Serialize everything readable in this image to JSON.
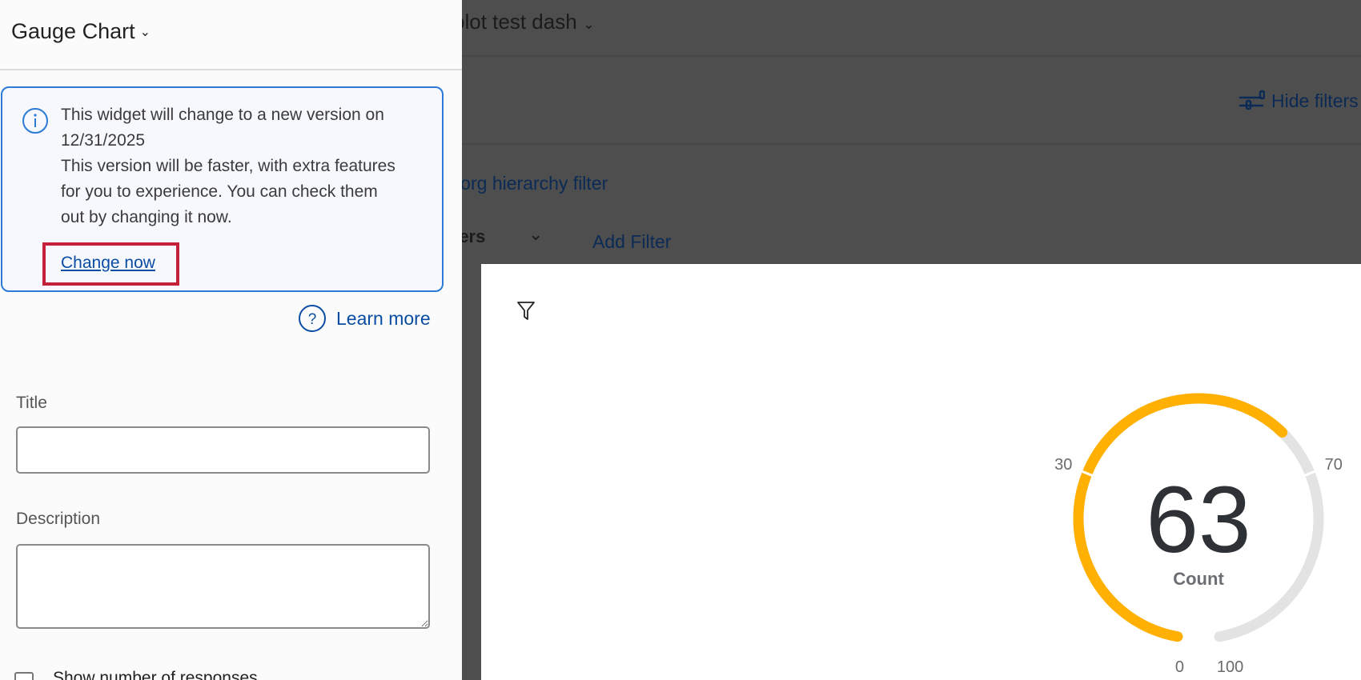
{
  "sidebar": {
    "widget_type": "Gauge Chart",
    "notice": {
      "lines": [
        "This widget will change to a new version on",
        "12/31/2025",
        "This version will be faster, with extra features",
        "for you to experience. You can check them",
        "out by changing it now."
      ],
      "action": "Change now"
    },
    "learn_more": "Learn more",
    "title_label": "Title",
    "title_value": "",
    "description_label": "Description",
    "description_value": "",
    "show_responses_label": "Show number of responses"
  },
  "background": {
    "dashboard_name": "plot test dash",
    "hide_filters": "Hide filters",
    "org_filter": "n org hierarchy filter",
    "filters_label": "ters",
    "add_filter": "Add Filter"
  },
  "colors": {
    "accent": "#0a4da2",
    "gauge_fill": "#ffb000",
    "gauge_track": "#e3e3e3",
    "highlight": "#c5203a"
  },
  "chart_data": {
    "type": "gauge",
    "value": 63,
    "value_label": "63",
    "metric_label": "Count",
    "min": 0,
    "max": 100,
    "thresholds": [
      30,
      70
    ],
    "tick_labels": [
      "0",
      "30",
      "70",
      "100"
    ]
  }
}
